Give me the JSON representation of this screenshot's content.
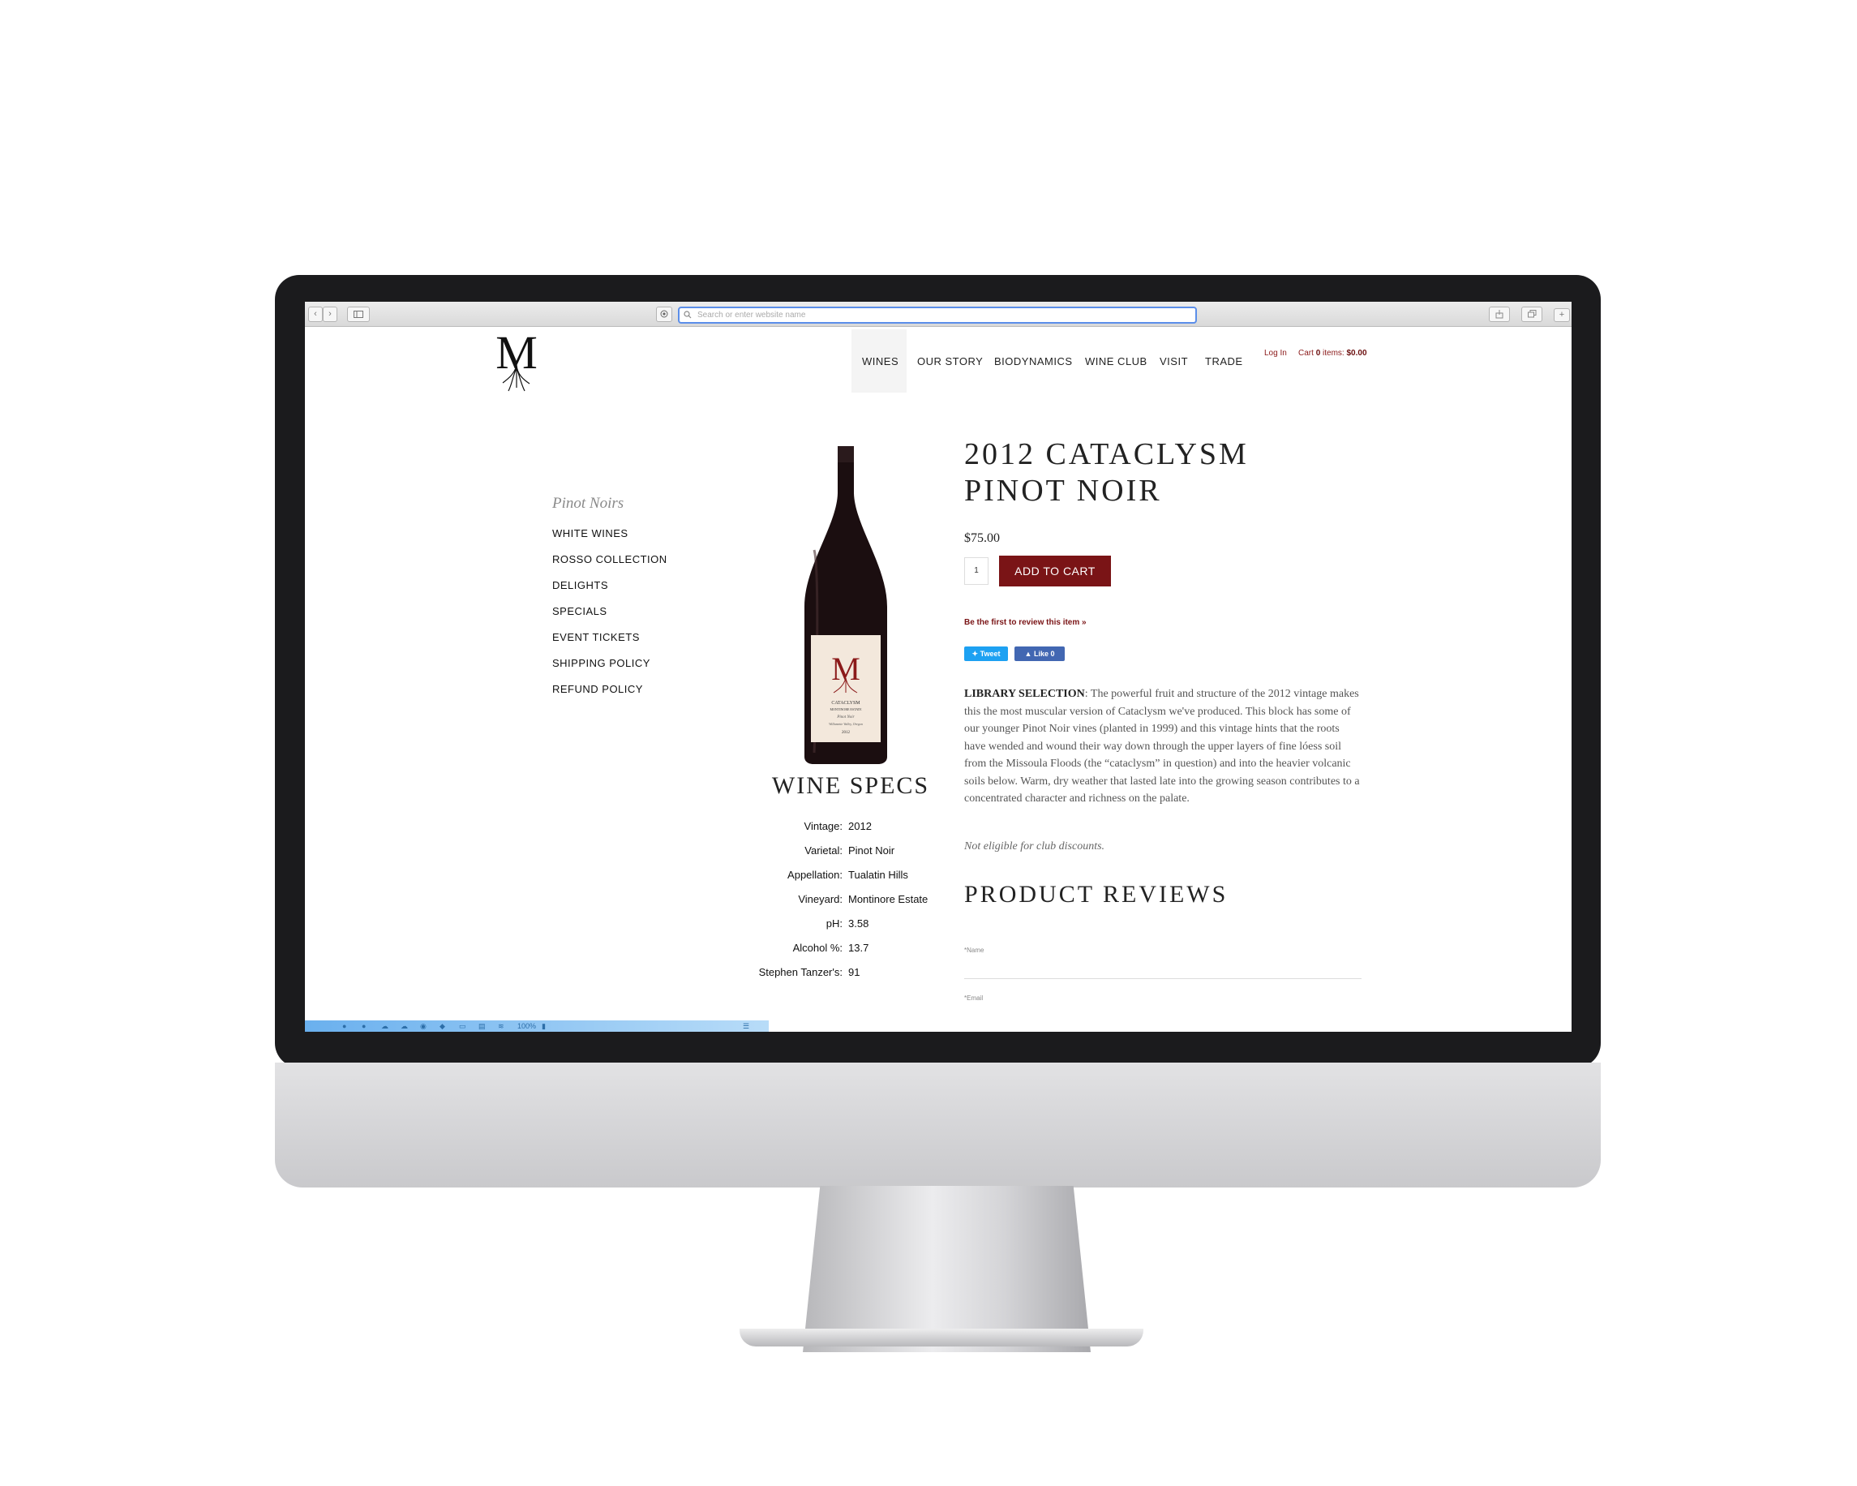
{
  "browser": {
    "address_placeholder": "Search or enter website name"
  },
  "site": {
    "logo_letter": "M",
    "nav": [
      "WINES",
      "OUR STORY",
      "BIODYNAMICS",
      "WINE CLUB",
      "VISIT",
      "TRADE"
    ],
    "login_label": "Log In",
    "cart_label": "Cart",
    "cart_count": "0",
    "cart_items_label": "items:",
    "cart_total": "$0.00"
  },
  "sidebar": {
    "title": "Pinot Noirs",
    "items": [
      "WHITE WINES",
      "ROSSO COLLECTION",
      "DELIGHTS",
      "SPECIALS",
      "EVENT TICKETS",
      "SHIPPING POLICY",
      "REFUND POLICY"
    ]
  },
  "bottle_label": {
    "logo_letter": "M",
    "name": "CATACLYSM",
    "estate": "MONTINORE ESTATE",
    "varietal": "Pinot Noir",
    "region": "Willamette Valley, Oregon",
    "year": "2012"
  },
  "specs": {
    "title": "WINE SPECS",
    "rows": [
      {
        "label": "Vintage:",
        "value": "2012"
      },
      {
        "label": "Varietal:",
        "value": "Pinot Noir"
      },
      {
        "label": "Appellation:",
        "value": "Tualatin Hills"
      },
      {
        "label": "Vineyard:",
        "value": "Montinore Estate"
      },
      {
        "label": "pH:",
        "value": "3.58"
      },
      {
        "label": "Alcohol %:",
        "value": "13.7"
      },
      {
        "label": "Stephen Tanzer's:",
        "value": "91"
      }
    ]
  },
  "product": {
    "title_line1": "2012 CATACLYSM",
    "title_line2": "PINOT NOIR",
    "price": "$75.00",
    "quantity": "1",
    "add_to_cart": "ADD TO CART",
    "review_link": "Be the first to review this item »",
    "tweet": "Tweet",
    "like": "Like 0",
    "desc_lead": "LIBRARY SELECTION",
    "desc_body": ": The powerful fruit and structure of the 2012 vintage makes this the most muscular version of Cataclysm we've produced. This block has some of our younger Pinot Noir vines (planted in 1999) and this vintage hints that the roots have wended and wound their way down through the upper layers of fine lóess soil from the Missoula Floods (the “cataclysm” in question) and into the heavier volcanic soils below. Warm, dry weather that lasted late into the growing season contributes to a concentrated character and richness on the palate.",
    "note": "Not eligible for club discounts.",
    "reviews_title": "PRODUCT REVIEWS",
    "name_label": "*Name",
    "email_label": "*Email"
  },
  "dock": {
    "battery": "100%"
  },
  "colors": {
    "accent": "#7a1416",
    "link": "#8b1a1a"
  }
}
